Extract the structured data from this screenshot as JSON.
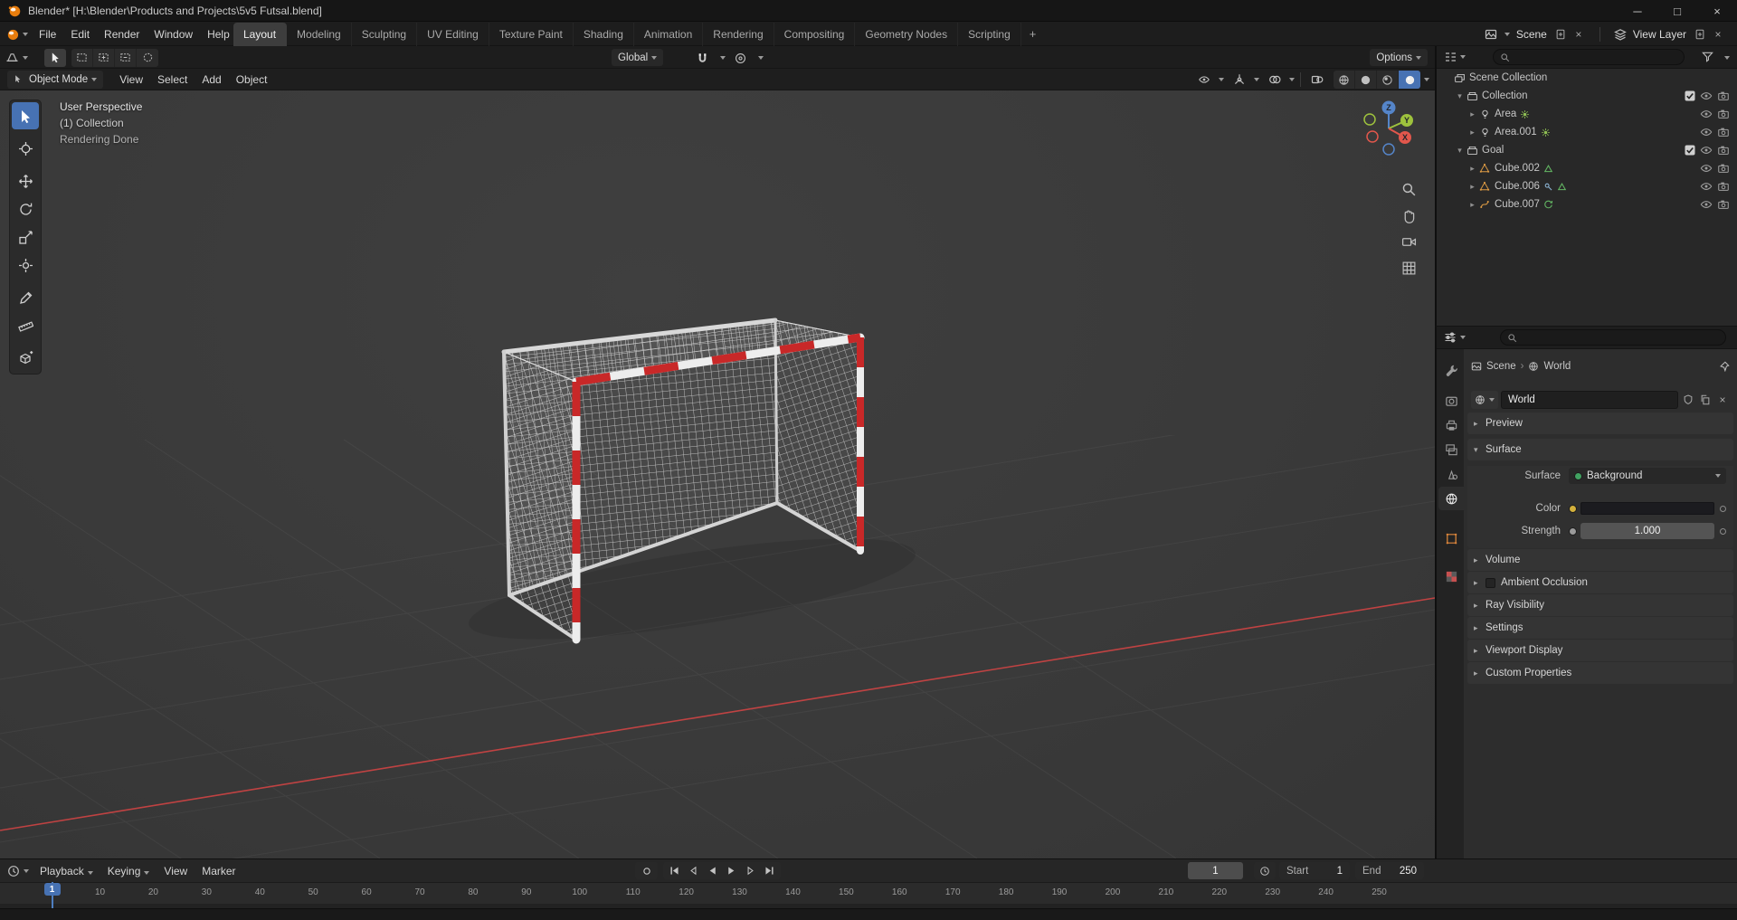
{
  "colors": {
    "accent": "#4772b3",
    "goal_red": "#c82828",
    "axis_red": "#cf4444"
  },
  "window": {
    "title": "Blender* [H:\\Blender\\Products and Projects\\5v5 Futsal.blend]",
    "minimize": "─",
    "maximize": "□",
    "close": "×"
  },
  "topbar": {
    "menus": [
      "File",
      "Edit",
      "Render",
      "Window",
      "Help"
    ],
    "workspaces": [
      "Layout",
      "Modeling",
      "Sculpting",
      "UV Editing",
      "Texture Paint",
      "Shading",
      "Animation",
      "Rendering",
      "Compositing",
      "Geometry Nodes",
      "Scripting"
    ],
    "active_workspace": "Layout",
    "add_workspace_label": "+",
    "scene_selector": {
      "value": "Scene"
    },
    "view_layer_selector": {
      "value": "View Layer"
    }
  },
  "toolbar_row": {
    "orientation": "Global",
    "options_label": "Options"
  },
  "viewport_header": {
    "mode": "Object Mode",
    "menus": [
      "View",
      "Select",
      "Add",
      "Object"
    ]
  },
  "viewport": {
    "overlay": [
      "User Perspective",
      "(1) Collection",
      "Rendering Done"
    ],
    "gizmo_axes": [
      "Z",
      "Y",
      "X"
    ]
  },
  "outliner": {
    "rows": [
      {
        "label": "Scene Collection",
        "indent": 0,
        "icon": "scene-collection",
        "arrow": "none",
        "badges": [],
        "controls": []
      },
      {
        "label": "Collection",
        "indent": 1,
        "icon": "collection",
        "arrow": "down",
        "badges": [],
        "controls": [
          "checkbox",
          "eye",
          "camera"
        ]
      },
      {
        "label": "Area",
        "indent": 2,
        "icon": "light",
        "arrow": "right",
        "badges": [
          "light-data"
        ],
        "controls": [
          "eye",
          "camera"
        ]
      },
      {
        "label": "Area.001",
        "indent": 2,
        "icon": "light",
        "arrow": "right",
        "badges": [
          "light-data"
        ],
        "controls": [
          "eye",
          "camera"
        ]
      },
      {
        "label": "Goal",
        "indent": 1,
        "icon": "collection",
        "arrow": "down",
        "badges": [],
        "controls": [
          "checkbox",
          "eye",
          "camera"
        ]
      },
      {
        "label": "Cube.002",
        "indent": 2,
        "icon": "mesh",
        "arrow": "right",
        "badges": [
          "mesh-data"
        ],
        "controls": [
          "eye",
          "camera"
        ]
      },
      {
        "label": "Cube.006",
        "indent": 2,
        "icon": "mesh",
        "arrow": "right",
        "badges": [
          "modifier",
          "mesh-data"
        ],
        "controls": [
          "eye",
          "camera"
        ]
      },
      {
        "label": "Cube.007",
        "indent": 2,
        "icon": "curve",
        "arrow": "right",
        "badges": [
          "curve-data"
        ],
        "controls": [
          "eye",
          "camera"
        ]
      }
    ]
  },
  "properties": {
    "breadcrumb": [
      "Scene",
      "World"
    ],
    "datablock_name": "World",
    "tabs": [
      "tool",
      "render",
      "output",
      "view-layer",
      "scene",
      "world",
      "object",
      "texture"
    ],
    "active_tab": "world",
    "panels": [
      {
        "label": "Preview",
        "expanded": false
      },
      {
        "label": "Surface",
        "expanded": true
      },
      {
        "label": "Volume",
        "expanded": false
      },
      {
        "label": "Ambient Occlusion",
        "expanded": false,
        "checkbox": true
      },
      {
        "label": "Ray Visibility",
        "expanded": false
      },
      {
        "label": "Settings",
        "expanded": false
      },
      {
        "label": "Viewport Display",
        "expanded": false
      },
      {
        "label": "Custom Properties",
        "expanded": false
      }
    ],
    "surface": {
      "rows": [
        {
          "label": "Surface",
          "type": "menu",
          "value": "Background"
        },
        {
          "label": "Color",
          "type": "color",
          "value": ""
        },
        {
          "label": "Strength",
          "type": "number",
          "value": "1.000"
        }
      ]
    }
  },
  "timeline": {
    "menus": [
      "Playback",
      "Keying",
      "View",
      "Marker"
    ],
    "current_frame": "1",
    "start": {
      "label": "Start",
      "value": "1"
    },
    "end": {
      "label": "End",
      "value": "250"
    },
    "ruler": {
      "ticks_from": 10,
      "ticks_to": 250,
      "ticks_step": 10
    }
  }
}
